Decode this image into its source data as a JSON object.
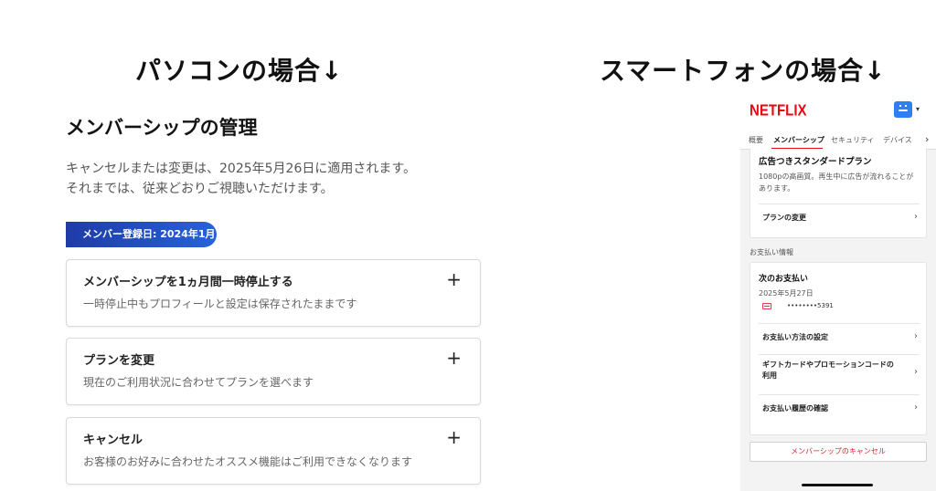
{
  "headings": {
    "pc": "パソコンの場合↓",
    "smartphone": "スマートフォンの場合↓"
  },
  "pc": {
    "title": "メンバーシップの管理",
    "notice_line1": "キャンセルまたは変更は、2025年5月26日に適用されます。",
    "notice_line2": "それまでは、従来どおりご視聴いただけます。",
    "member_since": "メンバー登録日: 2024年1月",
    "cards": [
      {
        "title": "メンバーシップを1ヵ月間一時停止する",
        "desc": "一時停止中もプロフィールと設定は保存されたままです",
        "icon": "plus-icon"
      },
      {
        "title": "プランを変更",
        "desc": "現在のご利用状況に合わせてプランを選べます",
        "icon": "plus-icon"
      },
      {
        "title": "キャンセル",
        "desc": "お客様のお好みに合わせたオススメ機能はご利用できなくなります",
        "icon": "plus-icon"
      }
    ],
    "plus_symbol": "+"
  },
  "phone": {
    "logo": "NETFLIX",
    "caret": "▾",
    "tabs": [
      "概要",
      "メンバーシップ",
      "セキュリティ",
      "デバイス"
    ],
    "tab_more": "›",
    "plan": {
      "name": "広告つきスタンダードプラン",
      "desc": "1080pの高画質。再生中に広告が流れることがあります。",
      "change_label": "プランの変更"
    },
    "payment_section_label": "お支払い情報",
    "payment": {
      "next_label": "次のお支払い",
      "next_date": "2025年5月27日",
      "card_number": "••••••••5391",
      "rows": [
        "お支払い方法の設定",
        "ギフトカードやプロモーションコードの利用",
        "お支払い履歴の確認"
      ]
    },
    "chevron": "›",
    "cancel_button": "メンバーシップのキャンセル",
    "accent_color": "#e50914"
  }
}
